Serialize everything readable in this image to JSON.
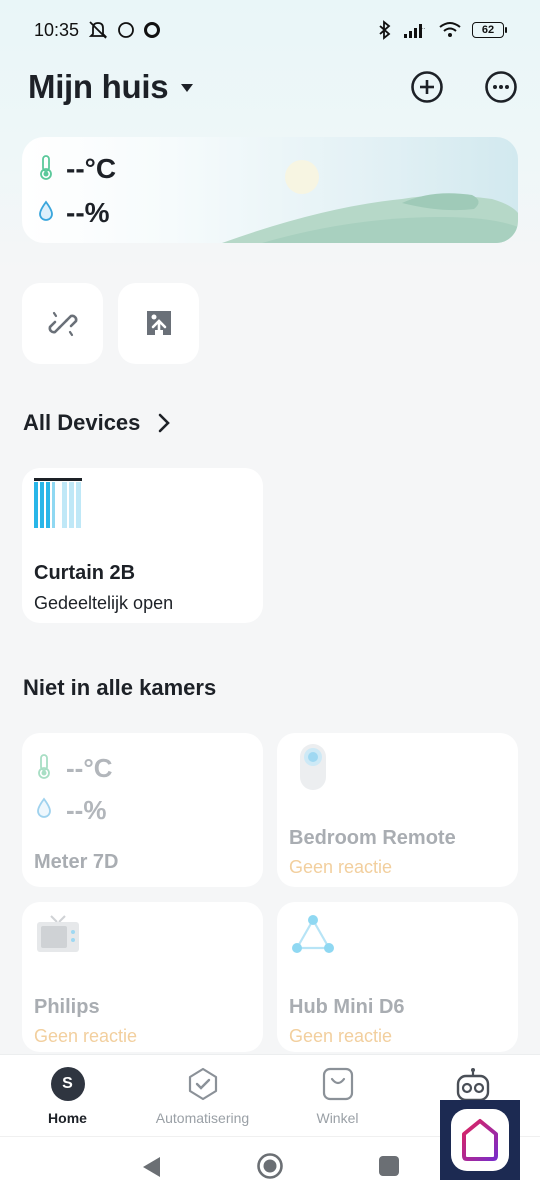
{
  "status_bar": {
    "time": "10:35",
    "battery": "62",
    "icons": [
      "mute-icon",
      "circle-icon",
      "ring-icon",
      "bluetooth-icon",
      "signal-icon",
      "wifi-icon",
      "battery-icon"
    ]
  },
  "header": {
    "title": "Mijn huis",
    "actions": [
      "add-icon",
      "more-icon"
    ]
  },
  "weather": {
    "temperature": "--°C",
    "humidity": "--%"
  },
  "quick_actions": [
    "link-icon",
    "share-icon"
  ],
  "sections": {
    "all_devices": "All Devices",
    "not_in_rooms": "Niet in alle kamers"
  },
  "devices": {
    "curtain": {
      "name": "Curtain 2B",
      "status": "Gedeeltelijk open"
    },
    "meter": {
      "name": "Meter 7D",
      "temperature": "--°C",
      "humidity": "--%"
    },
    "remote": {
      "name": "Bedroom Remote",
      "status": "Geen reactie"
    },
    "tv": {
      "name": "Philips",
      "status": "Geen reactie"
    },
    "hub": {
      "name": "Hub Mini D6",
      "status": "Geen reactie"
    }
  },
  "bottom_nav": {
    "avatar_letter": "S",
    "items": [
      {
        "label": "Home",
        "active": true
      },
      {
        "label": "Automatisering",
        "active": false
      },
      {
        "label": "Winkel",
        "active": false
      },
      {
        "label": "",
        "active": false
      }
    ]
  },
  "colors": {
    "offline": "#f2cf9e",
    "curtain_blue": "#29b6e8",
    "hub_blue": "#8fd8f2"
  }
}
